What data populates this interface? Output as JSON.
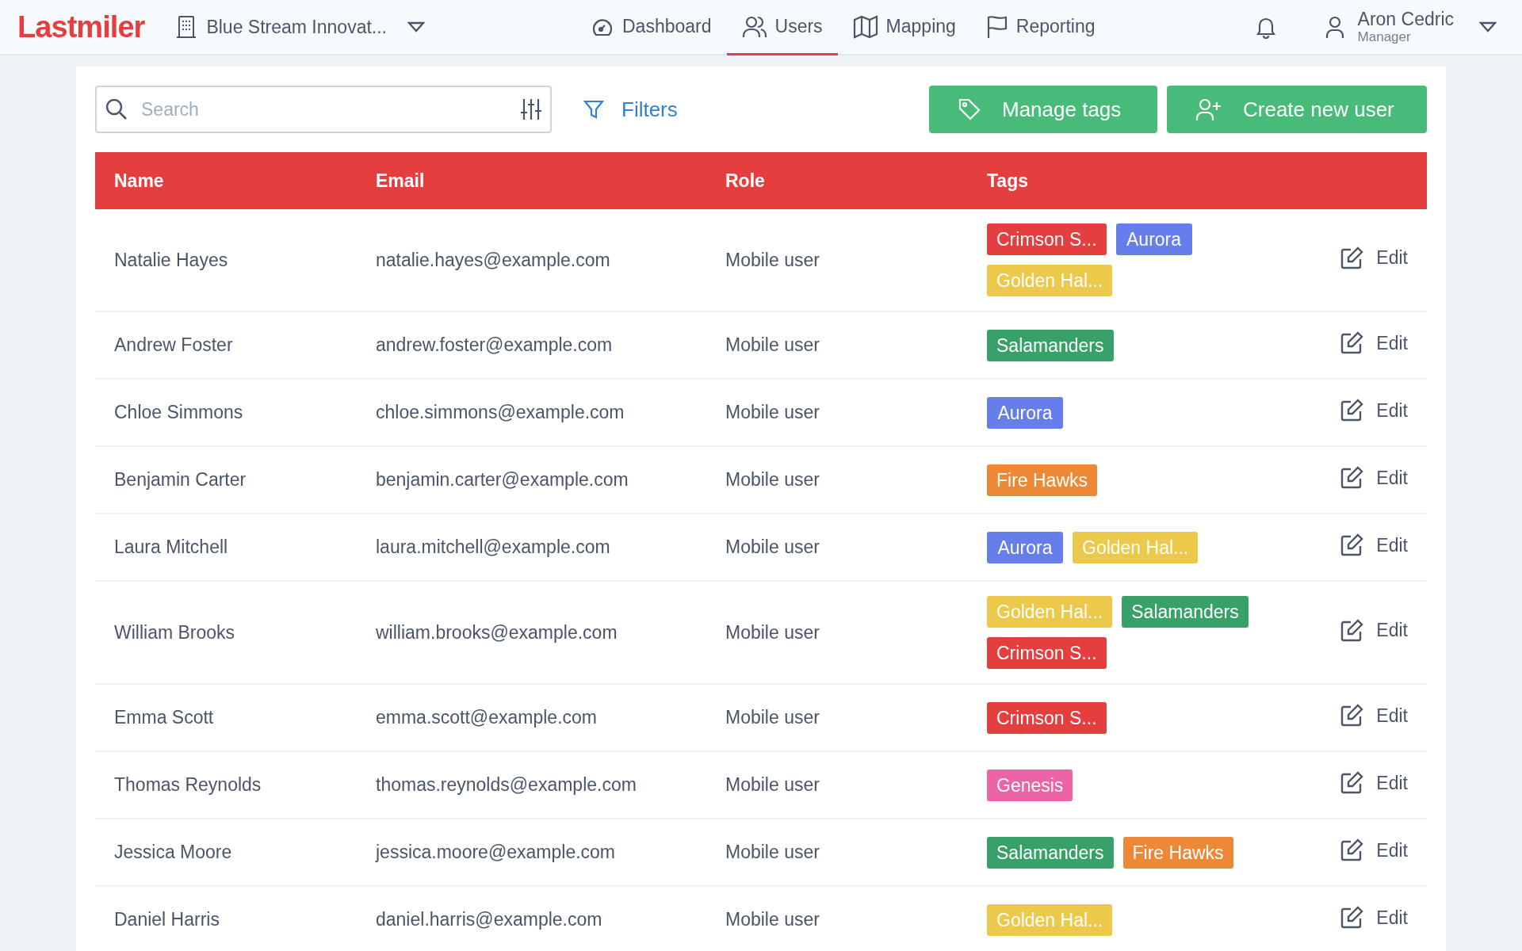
{
  "brand": "Lastmiler",
  "organization": "Blue Stream Innovat...",
  "nav": [
    {
      "label": "Dashboard",
      "kind": "gauge",
      "selected": false
    },
    {
      "label": "Users",
      "kind": "users",
      "selected": true
    },
    {
      "label": "Mapping",
      "kind": "map",
      "selected": false
    },
    {
      "label": "Reporting",
      "kind": "flag",
      "selected": false
    }
  ],
  "user": {
    "name": "Aron Cedric",
    "role": "Manager"
  },
  "search": {
    "placeholder": "Search"
  },
  "filters_label": "Filters",
  "buttons": [
    {
      "label": "Manage tags",
      "kind": "tag"
    },
    {
      "label": "Create new user",
      "kind": "add-user"
    }
  ],
  "table": {
    "columns": [
      "Name",
      "Email",
      "Role",
      "Tags"
    ],
    "rows": [
      {
        "name": "Natalie Hayes",
        "email": "natalie.hayes@example.com",
        "role": "Mobile user",
        "tags": [
          {
            "label": "Crimson S...",
            "color": "#e53e3e"
          },
          {
            "label": "Aurora",
            "color": "#667eea"
          },
          {
            "label": "Golden Hal...",
            "color": "#ecc94b"
          }
        ],
        "action": "Edit"
      },
      {
        "name": "Andrew Foster",
        "email": "andrew.foster@example.com",
        "role": "Mobile user",
        "tags": [
          {
            "label": "Salamanders",
            "color": "#38a169"
          }
        ],
        "action": "Edit"
      },
      {
        "name": "Chloe Simmons",
        "email": "chloe.simmons@example.com",
        "role": "Mobile user",
        "tags": [
          {
            "label": "Aurora",
            "color": "#667eea"
          }
        ],
        "action": "Edit"
      },
      {
        "name": "Benjamin Carter",
        "email": "benjamin.carter@example.com",
        "role": "Mobile user",
        "tags": [
          {
            "label": "Fire Hawks",
            "color": "#ed8936"
          }
        ],
        "action": "Edit"
      },
      {
        "name": "Laura Mitchell",
        "email": "laura.mitchell@example.com",
        "role": "Mobile user",
        "tags": [
          {
            "label": "Aurora",
            "color": "#667eea"
          },
          {
            "label": "Golden Hal...",
            "color": "#ecc94b"
          }
        ],
        "action": "Edit"
      },
      {
        "name": "William Brooks",
        "email": "william.brooks@example.com",
        "role": "Mobile user",
        "tags": [
          {
            "label": "Golden Hal...",
            "color": "#ecc94b"
          },
          {
            "label": "Salamanders",
            "color": "#38a169"
          },
          {
            "label": "Crimson S...",
            "color": "#e53e3e"
          }
        ],
        "action": "Edit"
      },
      {
        "name": "Emma Scott",
        "email": "emma.scott@example.com",
        "role": "Mobile user",
        "tags": [
          {
            "label": "Crimson S...",
            "color": "#e53e3e"
          }
        ],
        "action": "Edit"
      },
      {
        "name": "Thomas Reynolds",
        "email": "thomas.reynolds@example.com",
        "role": "Mobile user",
        "tags": [
          {
            "label": "Genesis",
            "color": "#ed64a6"
          }
        ],
        "action": "Edit"
      },
      {
        "name": "Jessica Moore",
        "email": "jessica.moore@example.com",
        "role": "Mobile user",
        "tags": [
          {
            "label": "Salamanders",
            "color": "#38a169"
          },
          {
            "label": "Fire Hawks",
            "color": "#ed8936"
          }
        ],
        "action": "Edit"
      },
      {
        "name": "Daniel Harris",
        "email": "daniel.harris@example.com",
        "role": "Mobile user",
        "tags": [
          {
            "label": "Golden Hal...",
            "color": "#ecc94b"
          }
        ],
        "action": "Edit"
      }
    ]
  }
}
